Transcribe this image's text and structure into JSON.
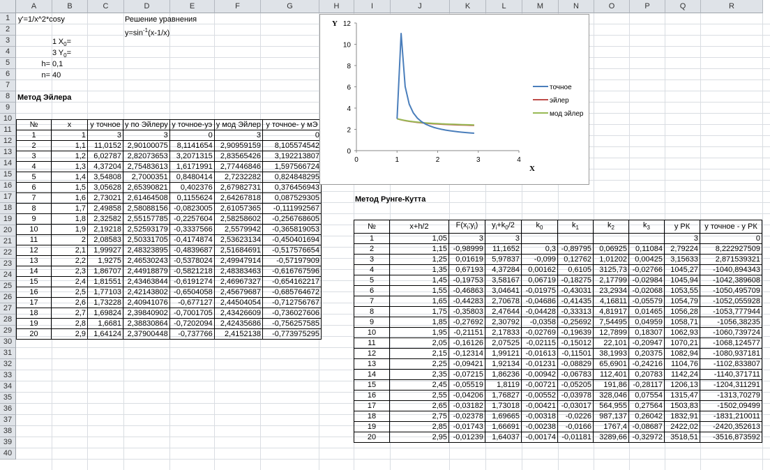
{
  "columns": [
    "A",
    "B",
    "C",
    "D",
    "E",
    "F",
    "G",
    "H",
    "I",
    "J",
    "K",
    "L",
    "M",
    "N",
    "O",
    "P",
    "Q",
    "R"
  ],
  "rows": [
    "1",
    "2",
    "3",
    "4",
    "5",
    "6",
    "7",
    "8",
    "9",
    "10",
    "11",
    "12",
    "13",
    "14",
    "15",
    "16",
    "17",
    "18",
    "19",
    "20",
    "21",
    "22",
    "23",
    "24",
    "25",
    "26",
    "27",
    "28",
    "29",
    "30",
    "31",
    "32",
    "33",
    "34",
    "35",
    "36",
    "37",
    "38",
    "39",
    "40"
  ],
  "header_cells": {
    "a1": "y'=1/x^2*cosy",
    "d1": "Решение уравнения",
    "d2_pre": "y=sin",
    "d2_sup": "-1",
    "d2_post": "(x-1/x)",
    "x0_label": "X",
    "x0_sub": "0",
    "x0_eq": "=",
    "x0_val": "1",
    "y0_label": "Y",
    "y0_sub": "0",
    "y0_eq": "=",
    "y0_val": "3",
    "h_label": "h=",
    "h_val": "0,1",
    "n_label": "n=",
    "n_val": "40",
    "euler_title": "Метод Эйлера",
    "rk_title": "Метод Рунге-Кутта"
  },
  "euler_table": {
    "headers": [
      "№",
      "x",
      "y точное",
      "y по Эйлеру",
      "y точное-уэ",
      "y мод Эйлер",
      "y точное- y мЭ"
    ],
    "rows": [
      [
        "1",
        "1",
        "3",
        "3",
        "0",
        "3",
        "0"
      ],
      [
        "2",
        "1,1",
        "11,0152",
        "2,90100075",
        "8,1141654",
        "2,90959159",
        "8,105574542"
      ],
      [
        "3",
        "1,2",
        "6,02787",
        "2,82073653",
        "3,2071315",
        "2,83565426",
        "3,192213807"
      ],
      [
        "4",
        "1,3",
        "4,37204",
        "2,75483613",
        "1,6171991",
        "2,77446846",
        "1,597566724"
      ],
      [
        "5",
        "1,4",
        "3,54808",
        "2,7000351",
        "0,8480414",
        "2,7232282",
        "0,824848295"
      ],
      [
        "6",
        "1,5",
        "3,05628",
        "2,65390821",
        "0,402376",
        "2,67982731",
        "0,376456943"
      ],
      [
        "7",
        "1,6",
        "2,73021",
        "2,61464508",
        "0,1155624",
        "2,64267818",
        "0,087529305"
      ],
      [
        "8",
        "1,7",
        "2,49858",
        "2,58088156",
        "-0,0823005",
        "2,61057365",
        "-0,111992567"
      ],
      [
        "9",
        "1,8",
        "2,32582",
        "2,55157785",
        "-0,2257604",
        "2,58258602",
        "-0,256768605"
      ],
      [
        "10",
        "1,9",
        "2,19218",
        "2,52593179",
        "-0,3337566",
        "2,5579942",
        "-0,365819053"
      ],
      [
        "11",
        "2",
        "2,08583",
        "2,50331705",
        "-0,4174874",
        "2,53623134",
        "-0,450401694"
      ],
      [
        "12",
        "2,1",
        "1,99927",
        "2,48323895",
        "-0,4839687",
        "2,51684691",
        "-0,517576654"
      ],
      [
        "13",
        "2,2",
        "1,9275",
        "2,46530243",
        "-0,5378024",
        "2,49947914",
        "-0,57197909"
      ],
      [
        "14",
        "2,3",
        "1,86707",
        "2,44918879",
        "-0,5821218",
        "2,48383463",
        "-0,616767596"
      ],
      [
        "15",
        "2,4",
        "1,81551",
        "2,43463844",
        "-0,6191274",
        "2,46967327",
        "-0,654162217"
      ],
      [
        "16",
        "2,5",
        "1,77103",
        "2,42143802",
        "-0,6504058",
        "2,45679687",
        "-0,685764672"
      ],
      [
        "17",
        "2,6",
        "1,73228",
        "2,40941076",
        "-0,677127",
        "2,44504054",
        "-0,712756767"
      ],
      [
        "18",
        "2,7",
        "1,69824",
        "2,39840902",
        "-0,7001705",
        "2,43426609",
        "-0,736027606"
      ],
      [
        "19",
        "2,8",
        "1,6681",
        "2,38830864",
        "-0,7202094",
        "2,42435686",
        "-0,756257585"
      ],
      [
        "20",
        "2,9",
        "1,64124",
        "2,37900448",
        "-0,737766",
        "2,4152138",
        "-0,773975295"
      ]
    ]
  },
  "rk_table": {
    "headers": {
      "n": "№",
      "xh2": "x+h/2",
      "f_pre": "F(x",
      "f_s1": "i",
      "f_mid": ";y",
      "f_s2": "i",
      "f_post": ")",
      "yk_pre": "y",
      "yk_s1": "i",
      "yk_mid": "+k",
      "yk_s2": "0",
      "yk_post": "/2",
      "k0_pre": "k",
      "k0_s": "0",
      "k1_pre": "k",
      "k1_s": "1",
      "k2_pre": "k",
      "k2_s": "2",
      "k3_pre": "k",
      "k3_s": "3",
      "yrk": "y РК",
      "diff": "y точное - y РК"
    },
    "rows": [
      [
        "1",
        "1,05",
        "3",
        "3",
        "",
        "",
        "",
        "",
        "3",
        "0"
      ],
      [
        "2",
        "1,15",
        "-0,98999",
        "11,1652",
        "0,3",
        "-0,89795",
        "0,06925",
        "0,11084",
        "2,79224",
        "8,222927509"
      ],
      [
        "3",
        "1,25",
        "0,01619",
        "5,97837",
        "-0,099",
        "0,12762",
        "1,01202",
        "0,00425",
        "3,15633",
        "2,871539321"
      ],
      [
        "4",
        "1,35",
        "0,67193",
        "4,37284",
        "0,00162",
        "0,6105",
        "3125,73",
        "-0,02766",
        "1045,27",
        "-1040,894343"
      ],
      [
        "5",
        "1,45",
        "-0,19753",
        "3,58167",
        "0,06719",
        "-0,18275",
        "2,17799",
        "-0,02984",
        "1045,94",
        "-1042,389608"
      ],
      [
        "6",
        "1,55",
        "-0,46863",
        "3,04641",
        "-0,01975",
        "-0,43031",
        "23,2934",
        "-0,02068",
        "1053,55",
        "-1050,495709"
      ],
      [
        "7",
        "1,65",
        "-0,44283",
        "2,70678",
        "-0,04686",
        "-0,41435",
        "4,16811",
        "-0,05579",
        "1054,79",
        "-1052,055928"
      ],
      [
        "8",
        "1,75",
        "-0,35803",
        "2,47644",
        "-0,04428",
        "-0,33313",
        "4,81917",
        "0,01465",
        "1056,28",
        "-1053,777944"
      ],
      [
        "9",
        "1,85",
        "-0,27692",
        "2,30792",
        "-0,0358",
        "-0,25692",
        "7,54495",
        "0,04959",
        "1058,71",
        "-1056,38235"
      ],
      [
        "10",
        "1,95",
        "-0,21151",
        "2,17833",
        "-0,02769",
        "-0,19639",
        "12,7899",
        "0,18307",
        "1062,93",
        "-1060,739724"
      ],
      [
        "11",
        "2,05",
        "-0,16126",
        "2,07525",
        "-0,02115",
        "-0,15012",
        "22,101",
        "-0,20947",
        "1070,21",
        "-1068,124577"
      ],
      [
        "12",
        "2,15",
        "-0,12314",
        "1,99121",
        "-0,01613",
        "-0,11501",
        "38,1993",
        "0,20375",
        "1082,94",
        "-1080,937181"
      ],
      [
        "13",
        "2,25",
        "-0,09421",
        "1,92134",
        "-0,01231",
        "-0,08829",
        "65,6901",
        "-0,24216",
        "1104,76",
        "-1102,833807"
      ],
      [
        "14",
        "2,35",
        "-0,07215",
        "1,86236",
        "-0,00942",
        "-0,06783",
        "112,401",
        "0,20783",
        "1142,24",
        "-1140,371711"
      ],
      [
        "15",
        "2,45",
        "-0,05519",
        "1,8119",
        "-0,00721",
        "-0,05205",
        "191,86",
        "-0,28117",
        "1206,13",
        "-1204,311291"
      ],
      [
        "16",
        "2,55",
        "-0,04206",
        "1,76827",
        "-0,00552",
        "-0,03978",
        "328,046",
        "0,07554",
        "1315,47",
        "-1313,70279"
      ],
      [
        "17",
        "2,65",
        "-0,03182",
        "1,73018",
        "-0,00421",
        "-0,03017",
        "564,955",
        "0,27564",
        "1503,83",
        "-1502,09499"
      ],
      [
        "18",
        "2,75",
        "-0,02378",
        "1,69665",
        "-0,00318",
        "-0,0226",
        "987,137",
        "0,26042",
        "1832,91",
        "-1831,210011"
      ],
      [
        "19",
        "2,85",
        "-0,01743",
        "1,66691",
        "-0,00238",
        "-0,0166",
        "1767,4",
        "-0,08687",
        "2422,02",
        "-2420,352613"
      ],
      [
        "20",
        "2,95",
        "-0,01239",
        "1,64037",
        "-0,00174",
        "-0,01181",
        "3289,66",
        "-0,32972",
        "3518,51",
        "-3516,873592"
      ]
    ]
  },
  "chart_data": {
    "type": "line",
    "xlabel": "X",
    "ylabel": "Y",
    "xlim": [
      0,
      4
    ],
    "ylim": [
      0,
      12
    ],
    "xticks": [
      "0",
      "1",
      "2",
      "3",
      "4"
    ],
    "yticks": [
      "0",
      "2",
      "4",
      "6",
      "8",
      "10",
      "12"
    ],
    "legend_position": "right",
    "series": [
      {
        "name": "точное",
        "color": "#4a7ebb",
        "x": [
          1,
          1.1,
          1.2,
          1.3,
          1.4,
          1.5,
          1.6,
          1.7,
          1.8,
          1.9,
          2,
          2.1,
          2.2,
          2.3,
          2.4,
          2.5,
          2.6,
          2.7,
          2.8,
          2.9
        ],
        "y": [
          3,
          11.0152,
          6.02787,
          4.37204,
          3.54808,
          3.05628,
          2.73021,
          2.49858,
          2.32582,
          2.19218,
          2.08583,
          1.99927,
          1.9275,
          1.86707,
          1.81551,
          1.77103,
          1.73228,
          1.69824,
          1.6681,
          1.64124
        ]
      },
      {
        "name": "эйлер",
        "color": "#be4b48",
        "x": [
          1,
          1.1,
          1.2,
          1.3,
          1.4,
          1.5,
          1.6,
          1.7,
          1.8,
          1.9,
          2,
          2.1,
          2.2,
          2.3,
          2.4,
          2.5,
          2.6,
          2.7,
          2.8,
          2.9
        ],
        "y": [
          3,
          2.90100075,
          2.82073653,
          2.75483613,
          2.7000351,
          2.65390821,
          2.61464508,
          2.58088156,
          2.55157785,
          2.52593179,
          2.50331705,
          2.48323895,
          2.46530243,
          2.44918879,
          2.43463844,
          2.42143802,
          2.40941076,
          2.39840902,
          2.38830864,
          2.37900448
        ]
      },
      {
        "name": "мод эйлер",
        "color": "#98b954",
        "x": [
          1,
          1.1,
          1.2,
          1.3,
          1.4,
          1.5,
          1.6,
          1.7,
          1.8,
          1.9,
          2,
          2.1,
          2.2,
          2.3,
          2.4,
          2.5,
          2.6,
          2.7,
          2.8,
          2.9
        ],
        "y": [
          3,
          2.90959159,
          2.83565426,
          2.77446846,
          2.7232282,
          2.67982731,
          2.64267818,
          2.61057365,
          2.58258602,
          2.5579942,
          2.53623134,
          2.51684691,
          2.49947914,
          2.48383463,
          2.46967327,
          2.45679687,
          2.44504054,
          2.43426609,
          2.42435686,
          2.4152138
        ]
      }
    ]
  }
}
